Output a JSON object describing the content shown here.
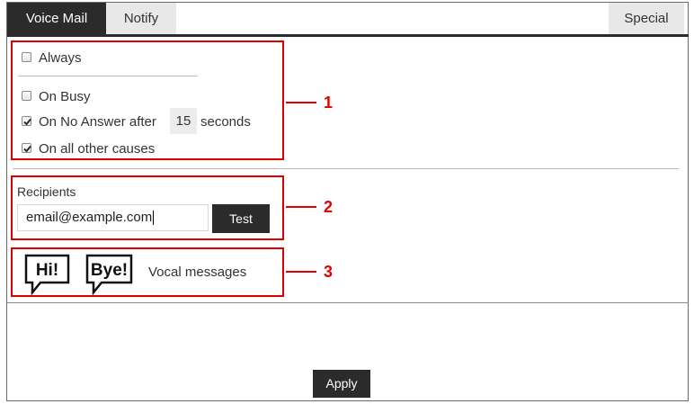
{
  "tabs": {
    "voicemail": "Voice Mail",
    "notify": "Notify",
    "special": "Special"
  },
  "options": {
    "always": {
      "label": "Always",
      "checked": false
    },
    "on_busy": {
      "label": "On Busy",
      "checked": false
    },
    "on_no_answer": {
      "label": "On No Answer after",
      "checked": true,
      "seconds_value": "15",
      "seconds_label": "seconds"
    },
    "on_all_other": {
      "label": "On all other causes",
      "checked": true
    }
  },
  "recipients": {
    "label": "Recipients",
    "email_value": "email@example.com",
    "test_label": "Test"
  },
  "vocal": {
    "hi_text": "Hi!",
    "bye_text": "Bye!",
    "label": "Vocal messages"
  },
  "apply_label": "Apply",
  "annotations": [
    "1",
    "2",
    "3"
  ],
  "colors": {
    "accent_dark": "#2b2b2b",
    "annotation_red": "#e00000",
    "tab_inactive": "#e8e8e8"
  }
}
